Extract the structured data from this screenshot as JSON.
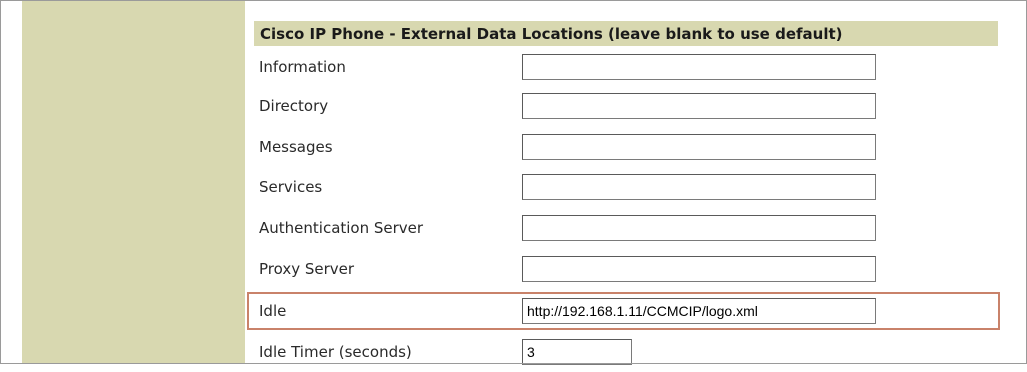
{
  "section": {
    "title": "Cisco IP Phone - External Data Locations (leave blank to use default)"
  },
  "fields": [
    {
      "label": "Information",
      "value": ""
    },
    {
      "label": "Directory",
      "value": ""
    },
    {
      "label": "Messages",
      "value": ""
    },
    {
      "label": "Services",
      "value": ""
    },
    {
      "label": "Authentication Server",
      "value": ""
    },
    {
      "label": "Proxy Server",
      "value": ""
    },
    {
      "label": "Idle",
      "value": "http://192.168.1.11/CCMCIP/logo.xml"
    },
    {
      "label": "Idle Timer (seconds)",
      "value": "3"
    }
  ],
  "colors": {
    "band": "#d8d8b0",
    "highlight": "#c9826a"
  }
}
